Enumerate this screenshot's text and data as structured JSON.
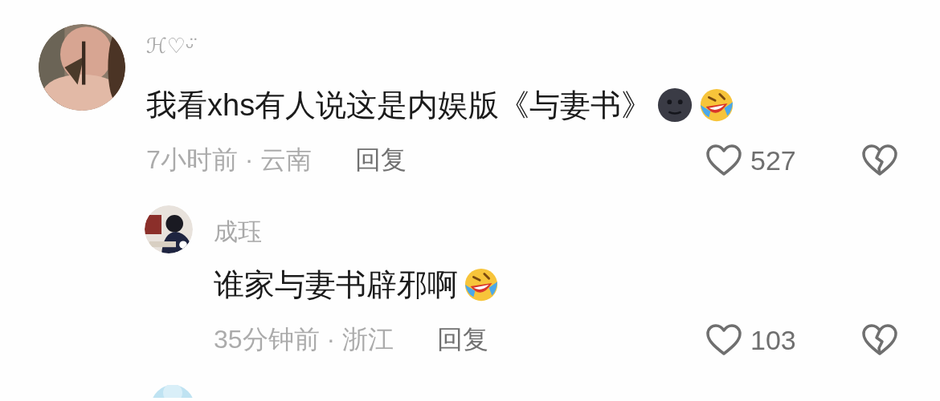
{
  "comments": [
    {
      "user": "ℋ♡ᵕ̈",
      "text": "我看xhs有人说这是内娱版《与妻书》",
      "emojis": [
        {
          "kind": "moon"
        },
        {
          "kind": "laugh"
        }
      ],
      "time_location": "7小时前 · 云南",
      "reply": "回复",
      "likes": "527",
      "replies": [
        {
          "user": "成珏",
          "text": "谁家与妻书辟邪啊",
          "emojis": [
            {
              "kind": "laugh"
            }
          ],
          "time_location": "35分钟前 · 浙江",
          "reply": "回复",
          "likes": "103"
        }
      ]
    }
  ]
}
